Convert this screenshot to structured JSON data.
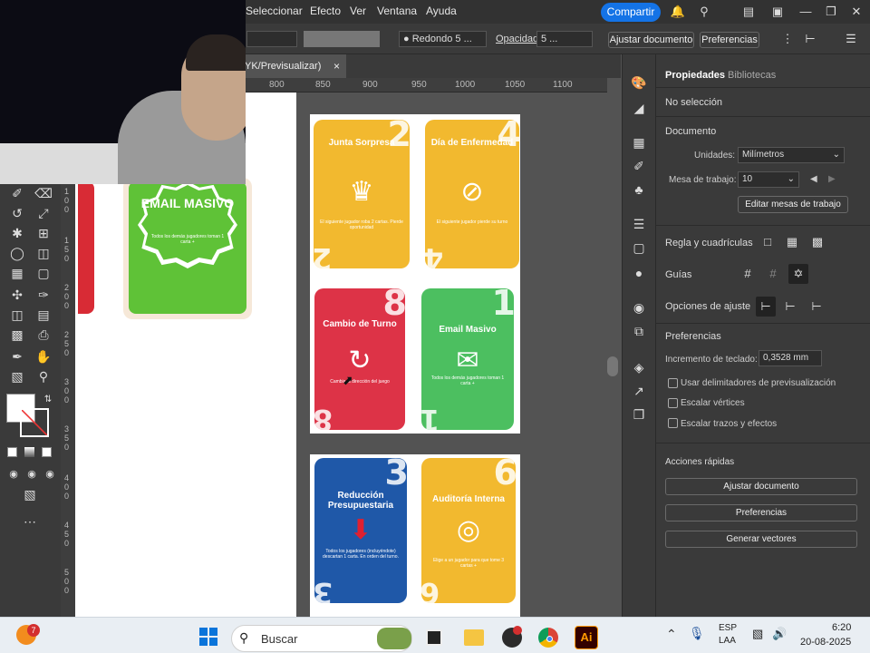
{
  "menu": {
    "items": [
      "Seleccionar",
      "Efecto",
      "Ver",
      "Ventana",
      "Ayuda"
    ],
    "share_label": "Compartir"
  },
  "control_bar": {
    "stroke_style": "Redondo 5 ...",
    "opacity_label": "Opacidad",
    "opacity_value": "5 ...",
    "fit_doc_label": "Ajustar documento",
    "prefs_label": "Preferencias"
  },
  "document_tab": {
    "title": "YK/Previsualizar)",
    "close": "×"
  },
  "ruler": {
    "ticks": [
      "800",
      "850",
      "900",
      "950",
      "1000",
      "1050",
      "1100"
    ]
  },
  "vruler": {
    "ticks": [
      "1\n0\n0",
      "1\n5\n0",
      "2\n0\n0",
      "2\n5\n0",
      "3\n0\n0",
      "3\n5\n0",
      "4\n0\n0",
      "4\n5\n0",
      "5\n0\n0"
    ]
  },
  "left_card": {
    "title": "EMAIL MASIVO",
    "desc": "Todos los demás jugadores toman 1 carta +"
  },
  "cards": [
    {
      "title": "Junta Sorpresa",
      "number": "2",
      "desc": "El siguiente jugador roba 2 cartas. Pierde oportunidad",
      "color": "#f2b92f",
      "icon": "crown-icon"
    },
    {
      "title": "Día de Enfermedad",
      "number": "4",
      "desc": "El siguiente jugador pierde su turno",
      "color": "#f2b92f",
      "icon": "no-entry-icon"
    },
    {
      "title": "Cambio de Turno",
      "number": "8",
      "desc": "Cambia la dirección del juego",
      "color": "#dd3347",
      "icon": "refresh-icon"
    },
    {
      "title": "Email Masivo",
      "number": "1",
      "desc": "Todos los demás jugadores toman 1 carta +",
      "color": "#4cbf60",
      "icon": "mail-icon"
    },
    {
      "title": "Reducción Presupuestaria",
      "number": "3",
      "desc": "Todos los jugadores (incluyéndote) descartan 1 carta. En orden del turno.",
      "color": "#1f58a8",
      "icon": "down-arrow-icon"
    },
    {
      "title": "Auditoría Interna",
      "number": "6",
      "desc": "Elige a un jugador para que tome 3 cartas +",
      "color": "#f2b92f",
      "icon": "target-icon"
    }
  ],
  "properties": {
    "tabs": [
      "Propiedades",
      "Bibliotecas"
    ],
    "selection": "No selección",
    "document_label": "Documento",
    "units_label": "Unidades:",
    "units_value": "Milímetros",
    "artboard_label": "Mesa de trabajo:",
    "artboard_value": "10",
    "edit_artboards": "Editar mesas de trabajo",
    "rulers_label": "Regla y cuadrículas",
    "guides_label": "Guías",
    "snap_label": "Opciones de ajuste",
    "prefs_title": "Preferencias",
    "keyboard_inc_label": "Incremento de teclado:",
    "keyboard_inc_value": "0,3528 mm",
    "chk1": "Usar delimitadores de previsualización",
    "chk2": "Escalar vértices",
    "chk3": "Escalar trazos y efectos",
    "quick_actions": "Acciones rápidas",
    "qa1": "Ajustar documento",
    "qa2": "Preferencias",
    "qa3": "Generar vectores"
  },
  "taskbar": {
    "search_placeholder": "Buscar",
    "lang1": "ESP",
    "lang2": "LAA",
    "time": "6:20",
    "date": "20-08-2025",
    "badge": "7",
    "ai_label": "Ai"
  }
}
